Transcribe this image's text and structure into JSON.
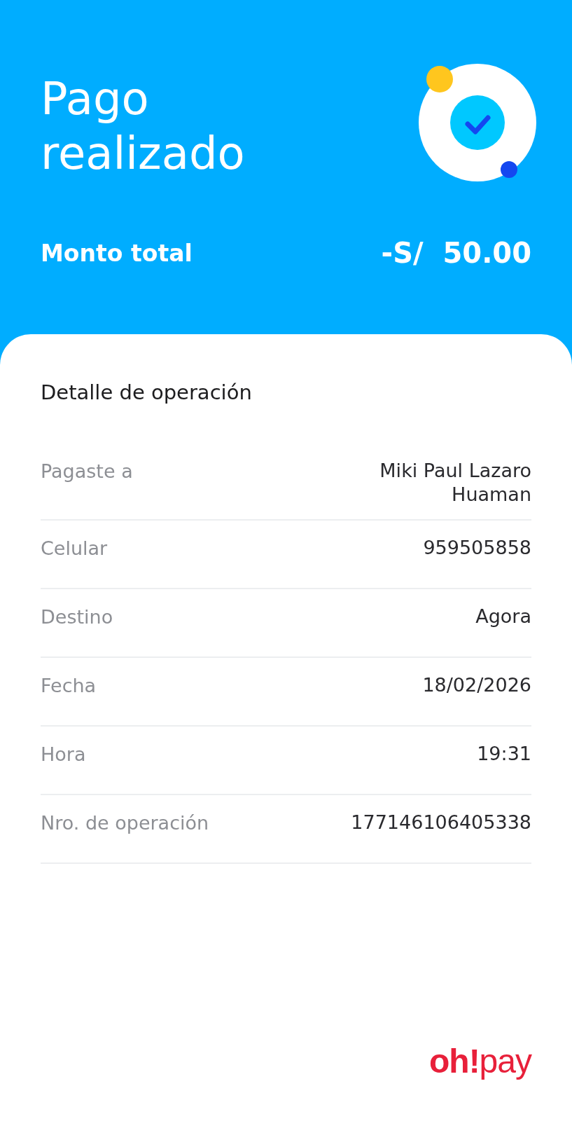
{
  "header": {
    "title": "Pago realizado",
    "total_label": "Monto total",
    "total_amount": "-S/  50.00"
  },
  "detail": {
    "title": "Detalle de operación",
    "rows": [
      {
        "label": "Pagaste a",
        "value": "Miki Paul Lazaro Huaman"
      },
      {
        "label": "Celular",
        "value": "959505858"
      },
      {
        "label": "Destino",
        "value": "Agora"
      },
      {
        "label": "Fecha",
        "value": "18/02/2026"
      },
      {
        "label": "Hora",
        "value": "19:31"
      },
      {
        "label": "Nro. de operación",
        "value": "177146106405338"
      }
    ]
  },
  "logo": "**oh!**pay"
}
